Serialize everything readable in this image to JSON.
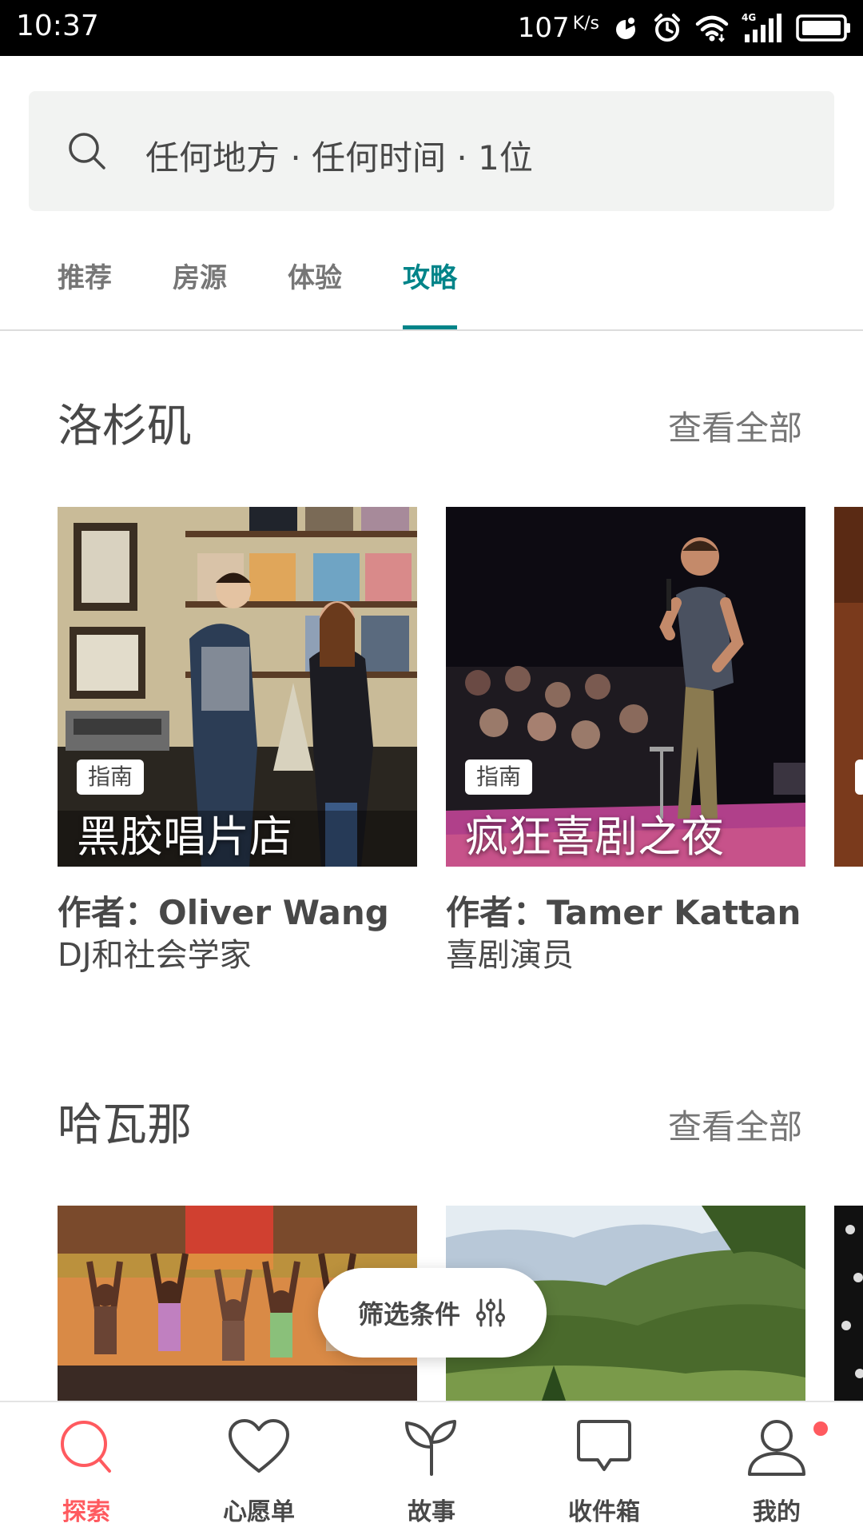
{
  "status_bar": {
    "time": "10:37",
    "net_speed": "107",
    "net_unit": "K/s",
    "icons": [
      "data-saver-icon",
      "alarm-icon",
      "wifi-icon",
      "signal-4g-icon",
      "battery-icon"
    ]
  },
  "search": {
    "text": "任何地方 · 任何时间 · 1位",
    "icon": "search-icon"
  },
  "tabs": [
    {
      "label": "推荐",
      "active": false
    },
    {
      "label": "房源",
      "active": false
    },
    {
      "label": "体验",
      "active": false
    },
    {
      "label": "攻略",
      "active": true
    }
  ],
  "accent_color": "#008489",
  "brand_color": "#ff5a5f",
  "sections": [
    {
      "title": "洛杉矶",
      "see_all": "查看全部",
      "cards": [
        {
          "badge": "指南",
          "title": "黑胶唱片店",
          "author": "作者：Oliver Wang",
          "role": "DJ和社会学家"
        },
        {
          "badge": "指南",
          "title": "疯狂喜剧之夜",
          "author": "作者：Tamer Kattan",
          "role": "喜剧演员"
        }
      ]
    },
    {
      "title": "哈瓦那",
      "see_all": "查看全部"
    }
  ],
  "filter_button": {
    "label": "筛选条件",
    "icon": "sliders-icon"
  },
  "bottom_nav": [
    {
      "label": "探索",
      "icon": "search-icon",
      "active": true
    },
    {
      "label": "心愿单",
      "icon": "heart-icon",
      "active": false
    },
    {
      "label": "故事",
      "icon": "sprout-icon",
      "active": false
    },
    {
      "label": "收件箱",
      "icon": "chat-bubble-icon",
      "active": false
    },
    {
      "label": "我的",
      "icon": "profile-icon",
      "active": false
    }
  ]
}
